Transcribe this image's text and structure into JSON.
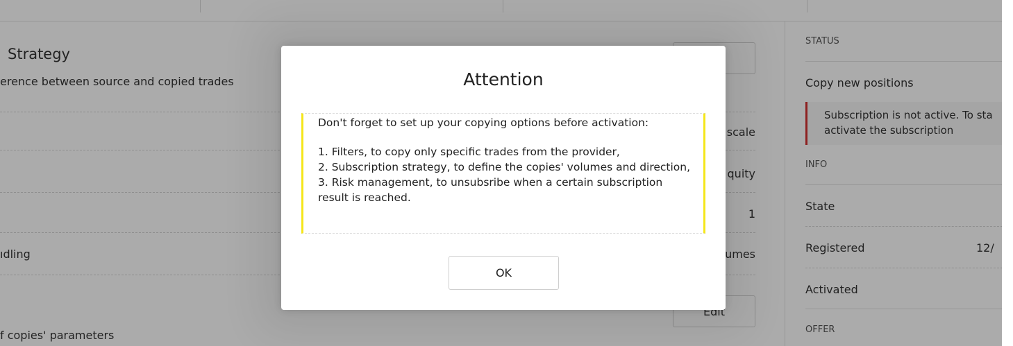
{
  "background": {
    "strategy": {
      "title": "Strategy",
      "subtitle": "erence between source and copied trades"
    },
    "rows": [
      {
        "label": "",
        "value": "scale"
      },
      {
        "label": "",
        "value": "quity"
      },
      {
        "label": "",
        "value": "1"
      },
      {
        "label": "ıdling",
        "value": "umes"
      }
    ],
    "edit_button": "Edit",
    "footer_text": "f copies' parameters"
  },
  "sidebar": {
    "status_heading": "STATUS",
    "copy_new_positions": "Copy new positions",
    "alert_line1": "Subscription is not active. To sta",
    "alert_line2": "activate the subscription",
    "info_heading": "INFO",
    "state_label": "State",
    "registered_label": "Registered",
    "registered_value": "12/",
    "activated_label": "Activated",
    "offer_heading": "OFFER"
  },
  "modal": {
    "title": "Attention",
    "intro": "Don't forget to set up your copying options before activation:",
    "items": [
      "1. Filters, to copy only specific trades from the provider,",
      "2. Subscription strategy, to define the copies' volumes and direction,",
      "3. Risk management, to unsubsribe when a certain subscription result is reached."
    ],
    "ok_label": "OK"
  },
  "colors": {
    "overlay": "rgba(0,0,0,0.33)",
    "notice_border": "#f5e61a",
    "alert_border": "#d32f2f"
  }
}
